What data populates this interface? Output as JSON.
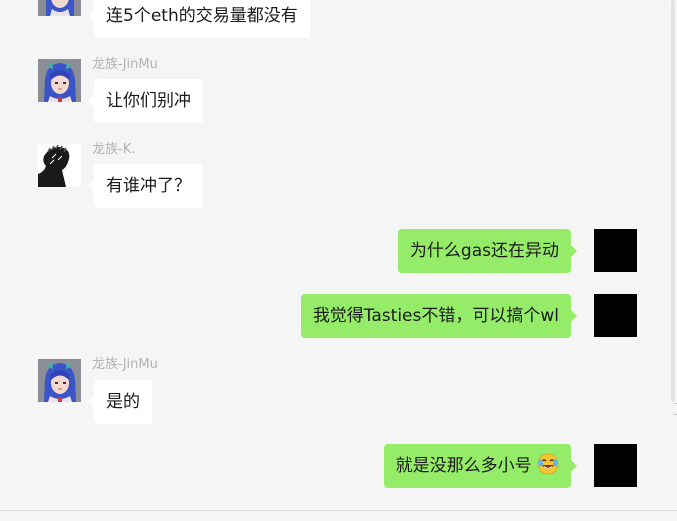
{
  "colors": {
    "background": "#f5f5f5",
    "incoming_bubble": "#ffffff",
    "outgoing_bubble": "#95ec69",
    "sender_name": "#b2b2b2"
  },
  "messages": [
    {
      "direction": "in",
      "text": "连5个eth的交易量都没有"
    },
    {
      "direction": "in",
      "sender": "龙族-JinMu",
      "text": "让你们别冲"
    },
    {
      "direction": "in",
      "sender": "龙族-K.",
      "text": "有谁冲了？"
    },
    {
      "direction": "out",
      "text": "为什么gas还在异动"
    },
    {
      "direction": "out",
      "text": "我觉得Tasties不错，可以搞个wl"
    },
    {
      "direction": "in",
      "sender": "龙族-JinMu",
      "text": "是的"
    },
    {
      "direction": "out",
      "text": "就是没那么多小号",
      "emoji": "crying-laughing-emoji"
    }
  ]
}
